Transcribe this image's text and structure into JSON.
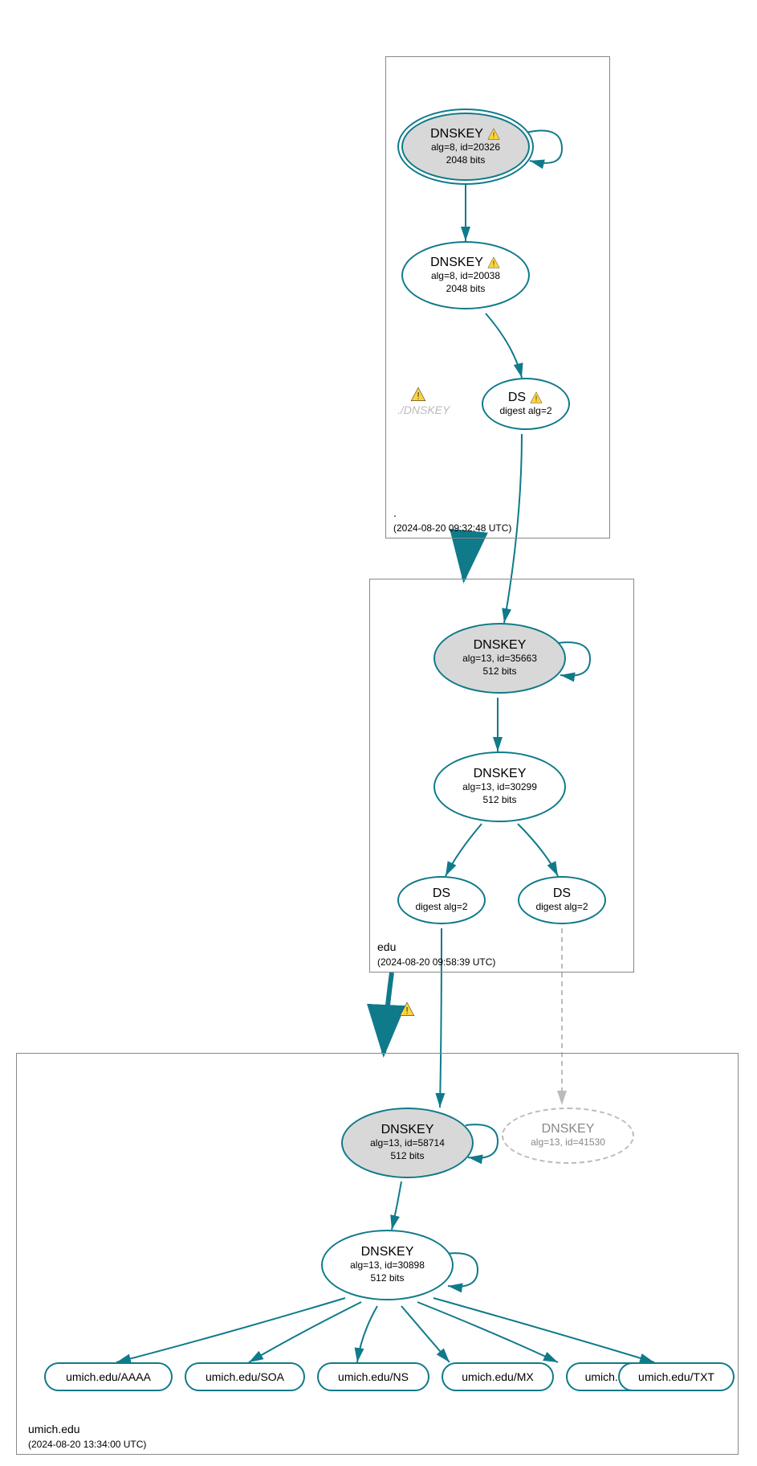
{
  "zones": {
    "root": {
      "label": ".",
      "timestamp": "(2024-08-20 09:32:48 UTC)",
      "nodes": {
        "dnskey_20326": {
          "title": "DNSKEY",
          "line1": "alg=8, id=20326",
          "line2": "2048 bits",
          "warning": true
        },
        "dnskey_20038": {
          "title": "DNSKEY",
          "line1": "alg=8, id=20038",
          "line2": "2048 bits",
          "warning": true
        },
        "ds": {
          "title": "DS",
          "line1": "digest alg=2",
          "warning": true
        },
        "faded_dnskey": "./DNSKEY"
      }
    },
    "edu": {
      "label": "edu",
      "timestamp": "(2024-08-20 09:58:39 UTC)",
      "nodes": {
        "dnskey_35663": {
          "title": "DNSKEY",
          "line1": "alg=13, id=35663",
          "line2": "512 bits"
        },
        "dnskey_30299": {
          "title": "DNSKEY",
          "line1": "alg=13, id=30299",
          "line2": "512 bits"
        },
        "ds_1": {
          "title": "DS",
          "line1": "digest alg=2"
        },
        "ds_2": {
          "title": "DS",
          "line1": "digest alg=2"
        }
      }
    },
    "umich": {
      "label": "umich.edu",
      "timestamp": "(2024-08-20 13:34:00 UTC)",
      "nodes": {
        "dnskey_58714": {
          "title": "DNSKEY",
          "line1": "alg=13, id=58714",
          "line2": "512 bits"
        },
        "dnskey_41530": {
          "title": "DNSKEY",
          "line1": "alg=13, id=41530"
        },
        "dnskey_30898": {
          "title": "DNSKEY",
          "line1": "alg=13, id=30898",
          "line2": "512 bits"
        }
      },
      "records": [
        "umich.edu/AAAA",
        "umich.edu/SOA",
        "umich.edu/NS",
        "umich.edu/MX",
        "umich.edu/A",
        "umich.edu/TXT"
      ]
    }
  }
}
